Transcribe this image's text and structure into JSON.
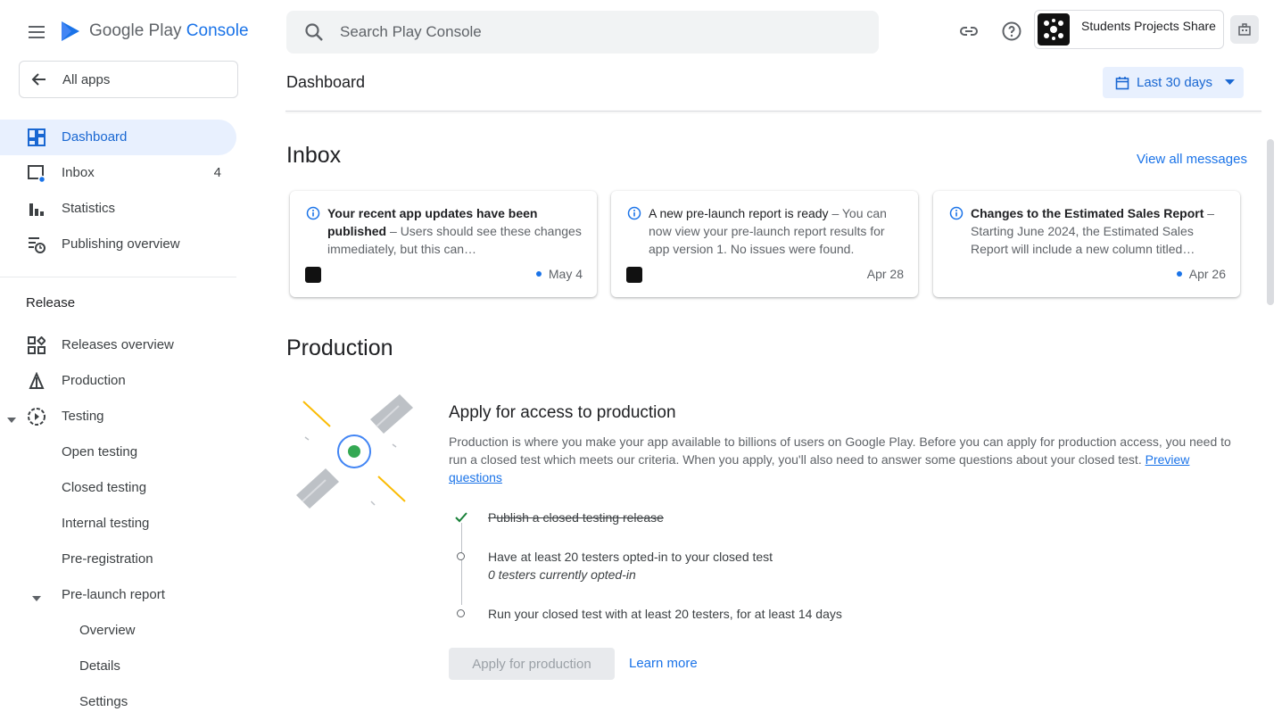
{
  "header": {
    "logo_google": "Google Play",
    "logo_console": "Console",
    "search_placeholder": "Search Play Console",
    "account_name": "Students Projects Share"
  },
  "sidebar": {
    "all_apps": "All apps",
    "items": [
      {
        "label": "Dashboard",
        "icon": "dashboard-icon"
      },
      {
        "label": "Inbox",
        "count": "4",
        "icon": "inbox-icon"
      },
      {
        "label": "Statistics",
        "icon": "bar-chart-icon"
      },
      {
        "label": "Publishing overview",
        "icon": "publishing-icon"
      }
    ],
    "section_release": "Release",
    "release_items": [
      {
        "label": "Releases overview",
        "icon": "releases-icon"
      },
      {
        "label": "Production",
        "icon": "production-icon"
      },
      {
        "label": "Testing",
        "icon": "testing-icon"
      },
      {
        "label": "Open testing"
      },
      {
        "label": "Closed testing"
      },
      {
        "label": "Internal testing"
      },
      {
        "label": "Pre-registration"
      },
      {
        "label": "Pre-launch report"
      },
      {
        "label": "Overview"
      },
      {
        "label": "Details"
      },
      {
        "label": "Settings"
      }
    ]
  },
  "main": {
    "page_title": "Dashboard",
    "date_range": "Last 30 days",
    "inbox": {
      "title": "Inbox",
      "view_all": "View all messages",
      "cards": [
        {
          "title": "Your recent app updates have been published",
          "body": "– Users should see these changes immediately, but this can…",
          "date": "May 4",
          "unread": true
        },
        {
          "title": "A new pre-launch report is ready",
          "body": "– You can now view your pre-launch report results for app version 1. No issues were found.",
          "date": "Apr 28",
          "unread": false
        },
        {
          "title": "Changes to the Estimated Sales Report",
          "body": "– Starting June 2024, the Estimated Sales Report will include a new column titled…",
          "date": "Apr 26",
          "unread": true
        }
      ]
    },
    "production": {
      "title": "Production",
      "heading": "Apply for access to production",
      "description": "Production is where you make your app available to billions of users on Google Play. Before you can apply for production access, you need to run a closed test which meets our criteria. When you apply, you'll also need to answer some questions about your closed test.",
      "preview_link": "Preview questions",
      "steps": [
        {
          "text": "Publish a closed testing release",
          "done": true
        },
        {
          "text": "Have at least 20 testers opted-in to your closed test",
          "sub": "0 testers currently opted-in",
          "done": false
        },
        {
          "text": "Run your closed test with at least 20 testers, for at least 14 days",
          "done": false
        }
      ],
      "apply_button": "Apply for production",
      "learn_more": "Learn more"
    }
  },
  "colors": {
    "accent": "#1a73e8",
    "active_bg": "#e8f0fe",
    "check": "#188038"
  }
}
